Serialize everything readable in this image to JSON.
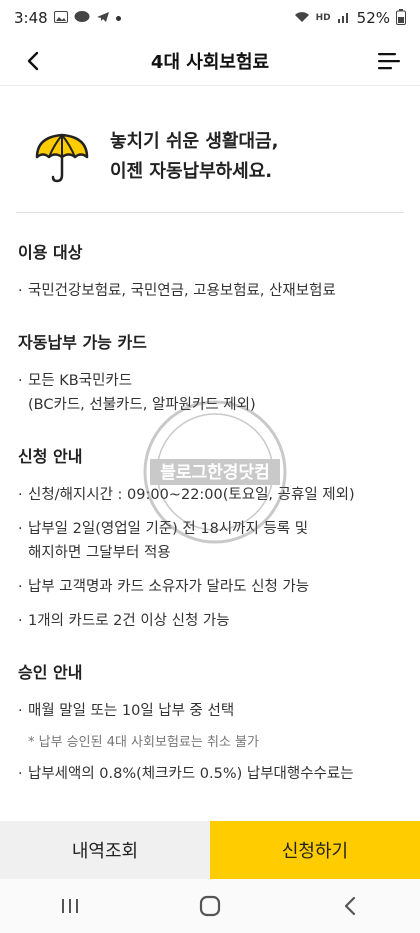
{
  "status": {
    "time": "3:48",
    "battery": "52%",
    "net_label": "HD"
  },
  "header": {
    "title": "4대 사회보험료"
  },
  "banner": {
    "line1": "놓치기 쉬운 생활대금,",
    "line2": "이젠 자동납부하세요."
  },
  "sections": [
    {
      "title": "이용 대상",
      "items": [
        "국민건강보험료, 국민연금, 고용보험료, 산재보험료"
      ]
    },
    {
      "title": "자동납부 가능 카드",
      "items": [
        "모든 KB국민카드\n(BC카드, 선불카드, 알파원카드 제외)"
      ]
    },
    {
      "title": "신청 안내",
      "items": [
        "신청/해지시간 : 09:00~22:00(토요일, 공휴일 제외)",
        "납부일 2일(영업일 기준) 전 18시까지 등록 및\n해지하면 그달부터 적용",
        "납부 고객명과 카드 소유자가 달라도 신청 가능",
        "1개의 카드로 2건 이상 신청 가능"
      ]
    },
    {
      "title": "승인 안내",
      "items": [
        "매월 말일 또는 10일 납부 중 선택",
        "납부세액의 0.8%(체크카드 0.5%) 납부대행수수료는"
      ],
      "note": "* 납부 승인된 4대 사회보험료는 취소 불가"
    }
  ],
  "watermark": {
    "text": "블로그한경닷컴"
  },
  "buttons": {
    "history": "내역조회",
    "apply": "신청하기"
  },
  "colors": {
    "accent": "#ffcc00",
    "secondary_button": "#f0f0f0"
  }
}
